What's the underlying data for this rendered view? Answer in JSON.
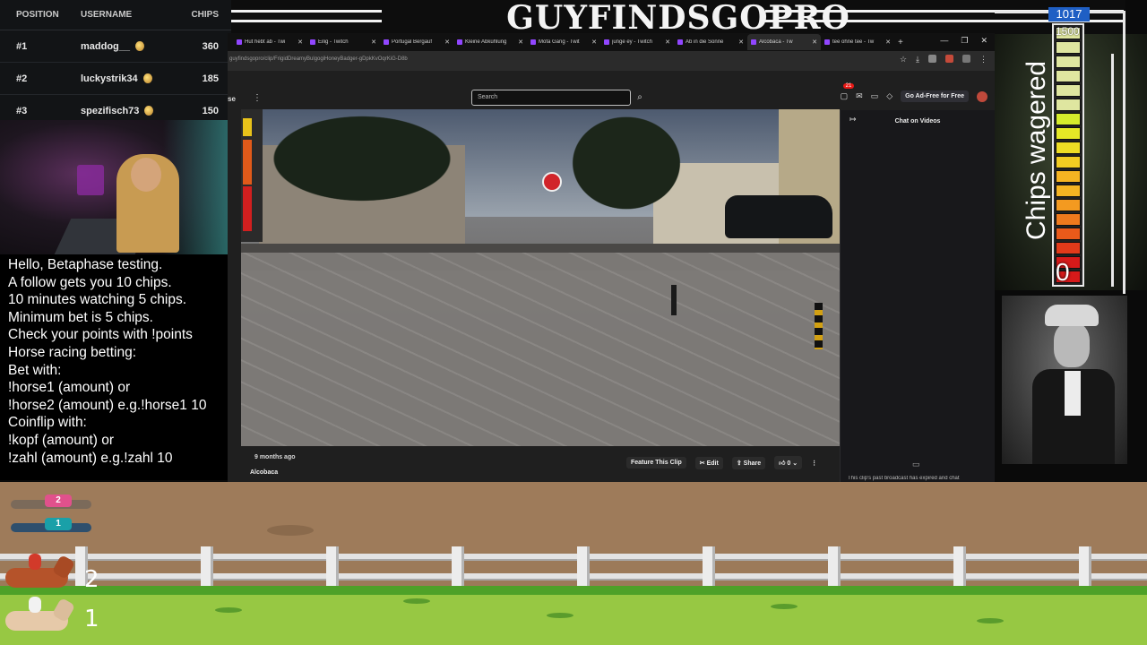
{
  "banner": {
    "title": "GUYFINDSGOPRO"
  },
  "leaderboard": {
    "headers": {
      "position": "POSITION",
      "username": "USERNAME",
      "chips": "CHIPS"
    },
    "rows": [
      {
        "position": "#1",
        "username": "maddog__",
        "chips": "360"
      },
      {
        "position": "#2",
        "username": "luckystrik34",
        "chips": "185"
      },
      {
        "position": "#3",
        "username": "spezifisch73",
        "chips": "150"
      }
    ]
  },
  "info": {
    "lines": [
      "Hello, Betaphase testing.",
      "A follow gets you 10 chips.",
      "10 minutes watching 5 chips.",
      "Minimum bet is 5 chips.",
      "Check your points with !points",
      "Horse racing betting:",
      "Bet with:",
      "!horse1 (amount) or",
      "!horse2 (amount) e.g.!horse1 10",
      "Coinflip with:",
      "!kopf (amount) or",
      "!zahl (amount) e.g.!zahl 10"
    ]
  },
  "browser": {
    "tabs": [
      {
        "label": "Hut hebt ab - Twi",
        "active": false
      },
      {
        "label": "Eilig - Twitch",
        "active": false
      },
      {
        "label": "Portugal Bergauf",
        "active": false
      },
      {
        "label": "Kleine Abkühlung",
        "active": false
      },
      {
        "label": "Mofa Gang - Twit",
        "active": false
      },
      {
        "label": "junge ey - Twitch",
        "active": false
      },
      {
        "label": "Ab in die Sonne",
        "active": false
      },
      {
        "label": "Alcobaca - Tw",
        "active": true
      },
      {
        "label": "tee ohne tee - Tw",
        "active": false
      }
    ],
    "new_tab": "+",
    "url": "guyfindsgopro/clip/FrigidDreamyBulgogiHoneyBadger-gDpkKvOqrKiG-D8b",
    "twitch": {
      "search_placeholder": "Search",
      "notifications_count": "21",
      "adfree_label": "Go Ad-Free for Free",
      "truncated_label": "se"
    },
    "video": {
      "age": "9 months ago",
      "title": "Alcobaca",
      "feature_label": "Feature This Clip",
      "edit_label": "Edit",
      "share_label": "Share",
      "like_count": "0"
    },
    "chat": {
      "title": "Chat on Videos",
      "footer": "This clip's past broadcast has expired and chat"
    }
  },
  "meter": {
    "label": "Chips wagered",
    "value": "1017",
    "max": "1500",
    "min": "0",
    "fill_fraction": 0.678
  },
  "race": {
    "dogs": [
      {
        "number": "2",
        "color": "#e0518c"
      },
      {
        "number": "1",
        "color": "#1aa0a8"
      }
    ],
    "horses": [
      {
        "number": "2"
      },
      {
        "number": "1"
      }
    ]
  },
  "colors": {
    "accent_blue": "#1f5fc4",
    "twitch_purple": "#9146ff",
    "notification_red": "#e91916",
    "grass": "#97c843",
    "dirt": "#9e7b5a"
  }
}
